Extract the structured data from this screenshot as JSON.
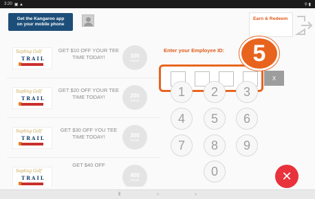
{
  "status_bar": {
    "time": "3:20",
    "left_icons": "▣ ▲",
    "right_icons": "⚲ ▮"
  },
  "banner": {
    "line1": "Get the Kangaroo app",
    "line2": "on your mobile phone"
  },
  "header": {
    "earn_redeem_label": "Earn & Redeem"
  },
  "rewards": [
    {
      "logo_script": "Sapling Golf",
      "logo_word": "TRAIL",
      "text": "GET $10 OFF YOUR TEE TIME TODAY!",
      "points": "100",
      "points_label": "Points"
    },
    {
      "logo_script": "Sapling Golf",
      "logo_word": "TRAIL",
      "text": "GET $20 OFF YOUR TEE TIME TODAY!",
      "points": "200",
      "points_label": "Points"
    },
    {
      "logo_script": "Sapling Golf",
      "logo_word": "TRAIL",
      "text": "GET $30 OFF YOU TEE TIME TODAY!",
      "points": "300",
      "points_label": "Points"
    },
    {
      "logo_script": "Sapling Golf",
      "logo_word": "TRAIL",
      "text": "GET $40 OFF",
      "points": "400",
      "points_label": "Points"
    }
  ],
  "employee": {
    "label": "Enter your Employee ID:",
    "clear_label": "X"
  },
  "step_badge": "5",
  "keypad": [
    "1",
    "2",
    "3",
    "4",
    "5",
    "6",
    "7",
    "8",
    "9",
    "0"
  ],
  "submit_glyph": "✕",
  "nav": {
    "recent": "⦀",
    "home": "○",
    "back": "‹"
  },
  "colors": {
    "accent": "#e8641e",
    "brand": "#1d4e79",
    "submit": "#e8323c"
  }
}
